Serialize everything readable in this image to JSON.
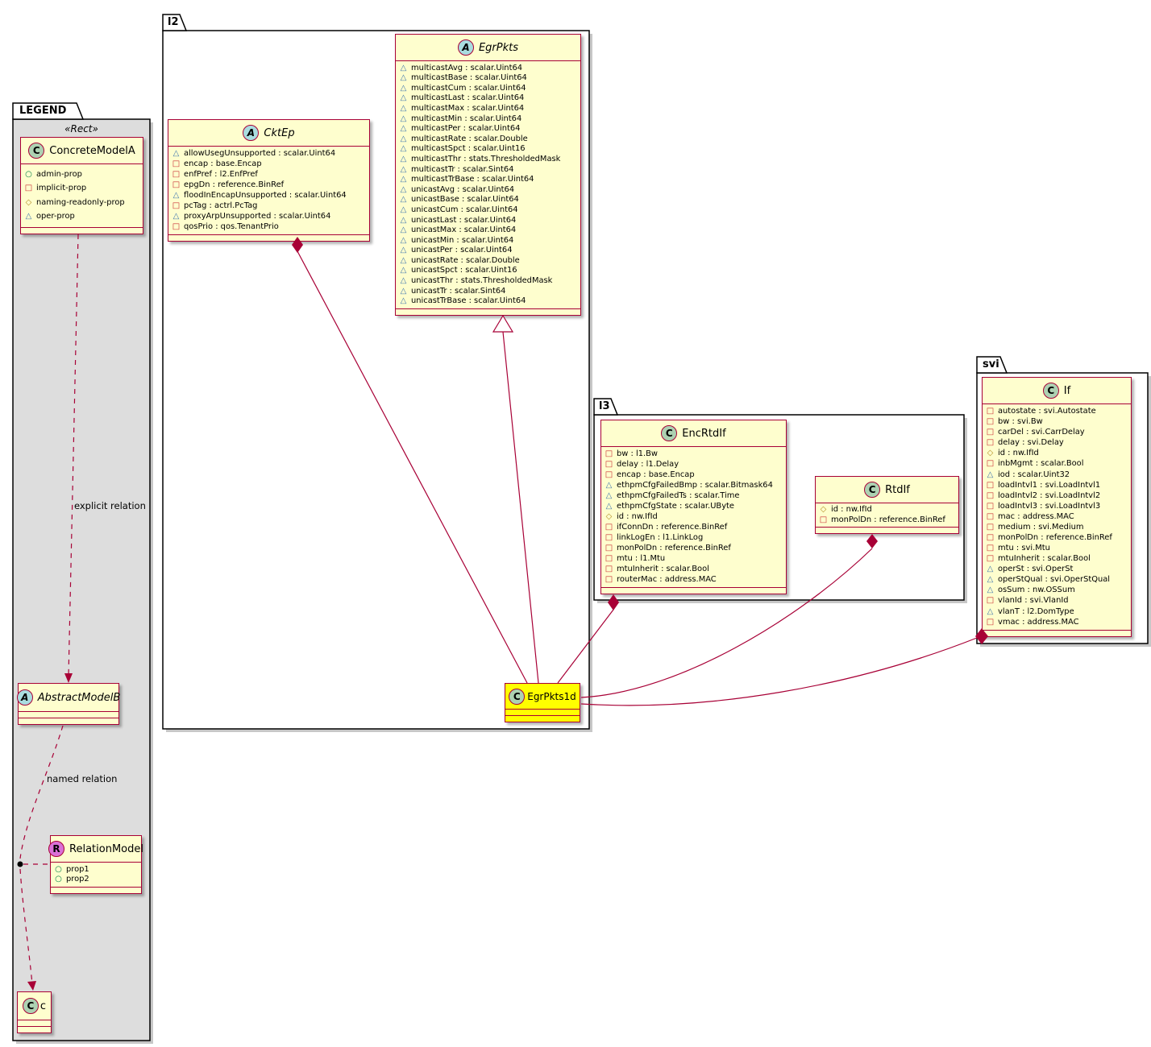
{
  "packages": {
    "legend": {
      "label": "LEGEND",
      "stereotype": "«Rect»"
    },
    "l2": {
      "label": "l2"
    },
    "l3": {
      "label": "l3"
    },
    "svi": {
      "label": "svi"
    }
  },
  "relations": {
    "explicit": {
      "label": "explicit relation"
    },
    "named": {
      "label": "named relation"
    }
  },
  "colors": {
    "accent": "#A80036",
    "class_bg": "#FEFECE",
    "highlight_bg": "#FFFF00",
    "spot_class": "#ADD1B2",
    "spot_abstract": "#A9DCDF",
    "spot_relation": "#DA70D6",
    "legend_bg": "#DDDDDD",
    "icon_circle": "#038048",
    "icon_square": "#C82930",
    "icon_diamond": "#B38D22",
    "icon_triangle": "#4177AF"
  },
  "classes": {
    "concrete": {
      "kind": "C",
      "name": "ConcreteModelA",
      "attrs": [
        {
          "icon": "circle",
          "text": "admin-prop"
        },
        {
          "icon": "square",
          "text": "implicit-prop"
        },
        {
          "icon": "diamond",
          "text": "naming-readonly-prop"
        },
        {
          "icon": "triangle",
          "text": "oper-prop"
        }
      ]
    },
    "abstractb": {
      "kind": "A",
      "name": "AbstractModelB",
      "attrs": []
    },
    "relation": {
      "kind": "R",
      "name": "RelationModel",
      "attrs": [
        {
          "icon": "circle",
          "text": "prop1"
        },
        {
          "icon": "circle",
          "text": "prop2"
        }
      ]
    },
    "smallc": {
      "kind": "C",
      "name": "c",
      "attrs": []
    },
    "cktep": {
      "kind": "A",
      "name": "CktEp",
      "attrs": [
        {
          "icon": "triangle",
          "text": "allowUsegUnsupported : scalar.Uint64"
        },
        {
          "icon": "square",
          "text": "encap : base.Encap"
        },
        {
          "icon": "square",
          "text": "enfPref : l2.EnfPref"
        },
        {
          "icon": "square",
          "text": "epgDn : reference.BinRef"
        },
        {
          "icon": "triangle",
          "text": "floodInEncapUnsupported : scalar.Uint64"
        },
        {
          "icon": "square",
          "text": "pcTag : actrl.PcTag"
        },
        {
          "icon": "triangle",
          "text": "proxyArpUnsupported : scalar.Uint64"
        },
        {
          "icon": "square",
          "text": "qosPrio : qos.TenantPrio"
        }
      ]
    },
    "egrpkts": {
      "kind": "A",
      "name": "EgrPkts",
      "attrs": [
        {
          "icon": "triangle",
          "text": "multicastAvg : scalar.Uint64"
        },
        {
          "icon": "triangle",
          "text": "multicastBase : scalar.Uint64"
        },
        {
          "icon": "triangle",
          "text": "multicastCum : scalar.Uint64"
        },
        {
          "icon": "triangle",
          "text": "multicastLast : scalar.Uint64"
        },
        {
          "icon": "triangle",
          "text": "multicastMax : scalar.Uint64"
        },
        {
          "icon": "triangle",
          "text": "multicastMin : scalar.Uint64"
        },
        {
          "icon": "triangle",
          "text": "multicastPer : scalar.Uint64"
        },
        {
          "icon": "triangle",
          "text": "multicastRate : scalar.Double"
        },
        {
          "icon": "triangle",
          "text": "multicastSpct : scalar.Uint16"
        },
        {
          "icon": "triangle",
          "text": "multicastThr : stats.ThresholdedMask"
        },
        {
          "icon": "triangle",
          "text": "multicastTr : scalar.Sint64"
        },
        {
          "icon": "triangle",
          "text": "multicastTrBase : scalar.Uint64"
        },
        {
          "icon": "triangle",
          "text": "unicastAvg : scalar.Uint64"
        },
        {
          "icon": "triangle",
          "text": "unicastBase : scalar.Uint64"
        },
        {
          "icon": "triangle",
          "text": "unicastCum : scalar.Uint64"
        },
        {
          "icon": "triangle",
          "text": "unicastLast : scalar.Uint64"
        },
        {
          "icon": "triangle",
          "text": "unicastMax : scalar.Uint64"
        },
        {
          "icon": "triangle",
          "text": "unicastMin : scalar.Uint64"
        },
        {
          "icon": "triangle",
          "text": "unicastPer : scalar.Uint64"
        },
        {
          "icon": "triangle",
          "text": "unicastRate : scalar.Double"
        },
        {
          "icon": "triangle",
          "text": "unicastSpct : scalar.Uint16"
        },
        {
          "icon": "triangle",
          "text": "unicastThr : stats.ThresholdedMask"
        },
        {
          "icon": "triangle",
          "text": "unicastTr : scalar.Sint64"
        },
        {
          "icon": "triangle",
          "text": "unicastTrBase : scalar.Uint64"
        }
      ]
    },
    "egrpkts1d": {
      "kind": "C",
      "name": "EgrPkts1d",
      "attrs": []
    },
    "encrtdif": {
      "kind": "C",
      "name": "EncRtdIf",
      "attrs": [
        {
          "icon": "square",
          "text": "bw : l1.Bw"
        },
        {
          "icon": "square",
          "text": "delay : l1.Delay"
        },
        {
          "icon": "square",
          "text": "encap : base.Encap"
        },
        {
          "icon": "triangle",
          "text": "ethpmCfgFailedBmp : scalar.Bitmask64"
        },
        {
          "icon": "triangle",
          "text": "ethpmCfgFailedTs : scalar.Time"
        },
        {
          "icon": "triangle",
          "text": "ethpmCfgState : scalar.UByte"
        },
        {
          "icon": "diamond",
          "text": "id : nw.IfId"
        },
        {
          "icon": "square",
          "text": "ifConnDn : reference.BinRef"
        },
        {
          "icon": "square",
          "text": "linkLogEn : l1.LinkLog"
        },
        {
          "icon": "square",
          "text": "monPolDn : reference.BinRef"
        },
        {
          "icon": "square",
          "text": "mtu : l1.Mtu"
        },
        {
          "icon": "square",
          "text": "mtuInherit : scalar.Bool"
        },
        {
          "icon": "square",
          "text": "routerMac : address.MAC"
        }
      ]
    },
    "rtdif": {
      "kind": "C",
      "name": "RtdIf",
      "attrs": [
        {
          "icon": "diamond",
          "text": "id : nw.IfId"
        },
        {
          "icon": "square",
          "text": "monPolDn : reference.BinRef"
        }
      ]
    },
    "sviif": {
      "kind": "C",
      "name": "If",
      "attrs": [
        {
          "icon": "square",
          "text": "autostate : svi.Autostate"
        },
        {
          "icon": "square",
          "text": "bw : svi.Bw"
        },
        {
          "icon": "square",
          "text": "carDel : svi.CarrDelay"
        },
        {
          "icon": "square",
          "text": "delay : svi.Delay"
        },
        {
          "icon": "diamond",
          "text": "id : nw.IfId"
        },
        {
          "icon": "square",
          "text": "inbMgmt : scalar.Bool"
        },
        {
          "icon": "triangle",
          "text": "iod : scalar.Uint32"
        },
        {
          "icon": "square",
          "text": "loadIntvl1 : svi.LoadIntvl1"
        },
        {
          "icon": "square",
          "text": "loadIntvl2 : svi.LoadIntvl2"
        },
        {
          "icon": "square",
          "text": "loadIntvl3 : svi.LoadIntvl3"
        },
        {
          "icon": "square",
          "text": "mac : address.MAC"
        },
        {
          "icon": "square",
          "text": "medium : svi.Medium"
        },
        {
          "icon": "square",
          "text": "monPolDn : reference.BinRef"
        },
        {
          "icon": "square",
          "text": "mtu : svi.Mtu"
        },
        {
          "icon": "square",
          "text": "mtuInherit : scalar.Bool"
        },
        {
          "icon": "triangle",
          "text": "operSt : svi.OperSt"
        },
        {
          "icon": "triangle",
          "text": "operStQual : svi.OperStQual"
        },
        {
          "icon": "triangle",
          "text": "osSum : nw.OSSum"
        },
        {
          "icon": "square",
          "text": "vlanId : svi.VlanId"
        },
        {
          "icon": "triangle",
          "text": "vlanT : l2.DomType"
        },
        {
          "icon": "square",
          "text": "vmac : address.MAC"
        }
      ]
    }
  }
}
